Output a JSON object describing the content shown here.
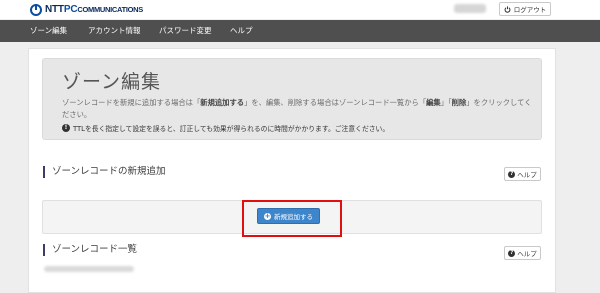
{
  "header": {
    "logo_ntt": "NTT",
    "logo_pc": "PC",
    "logo_comm": "COMMUNICATIONS",
    "logout_label": "ログアウト"
  },
  "nav": {
    "items": [
      {
        "label": "ゾーン編集"
      },
      {
        "label": "アカウント情報"
      },
      {
        "label": "パスワード変更"
      },
      {
        "label": "ヘルプ"
      }
    ]
  },
  "jumbotron": {
    "title": "ゾーン編集",
    "desc_part1": "ゾーンレコードを新規に追加する場合は「",
    "desc_bold1": "新規追加する",
    "desc_part2": "」を、編集、削除する場合はゾーンレコード一覧から「",
    "desc_bold2": "編集",
    "desc_part3": "」「",
    "desc_bold3": "削除",
    "desc_part4": "」をクリックしてください。",
    "warning": "TTLを長く指定して設定を誤ると、訂正しても効果が得られるのに時間がかかります。ご注意ください。"
  },
  "sections": {
    "add_title": "ゾーンレコードの新規追加",
    "list_title": "ゾーンレコード一覧",
    "help_label": "ヘルプ",
    "add_button_label": "新規追加する"
  },
  "colors": {
    "nav_bg": "#4f4f4f",
    "primary_button": "#3d86cc",
    "highlight_border": "#e01010",
    "logo_blue": "#0a4da2"
  }
}
